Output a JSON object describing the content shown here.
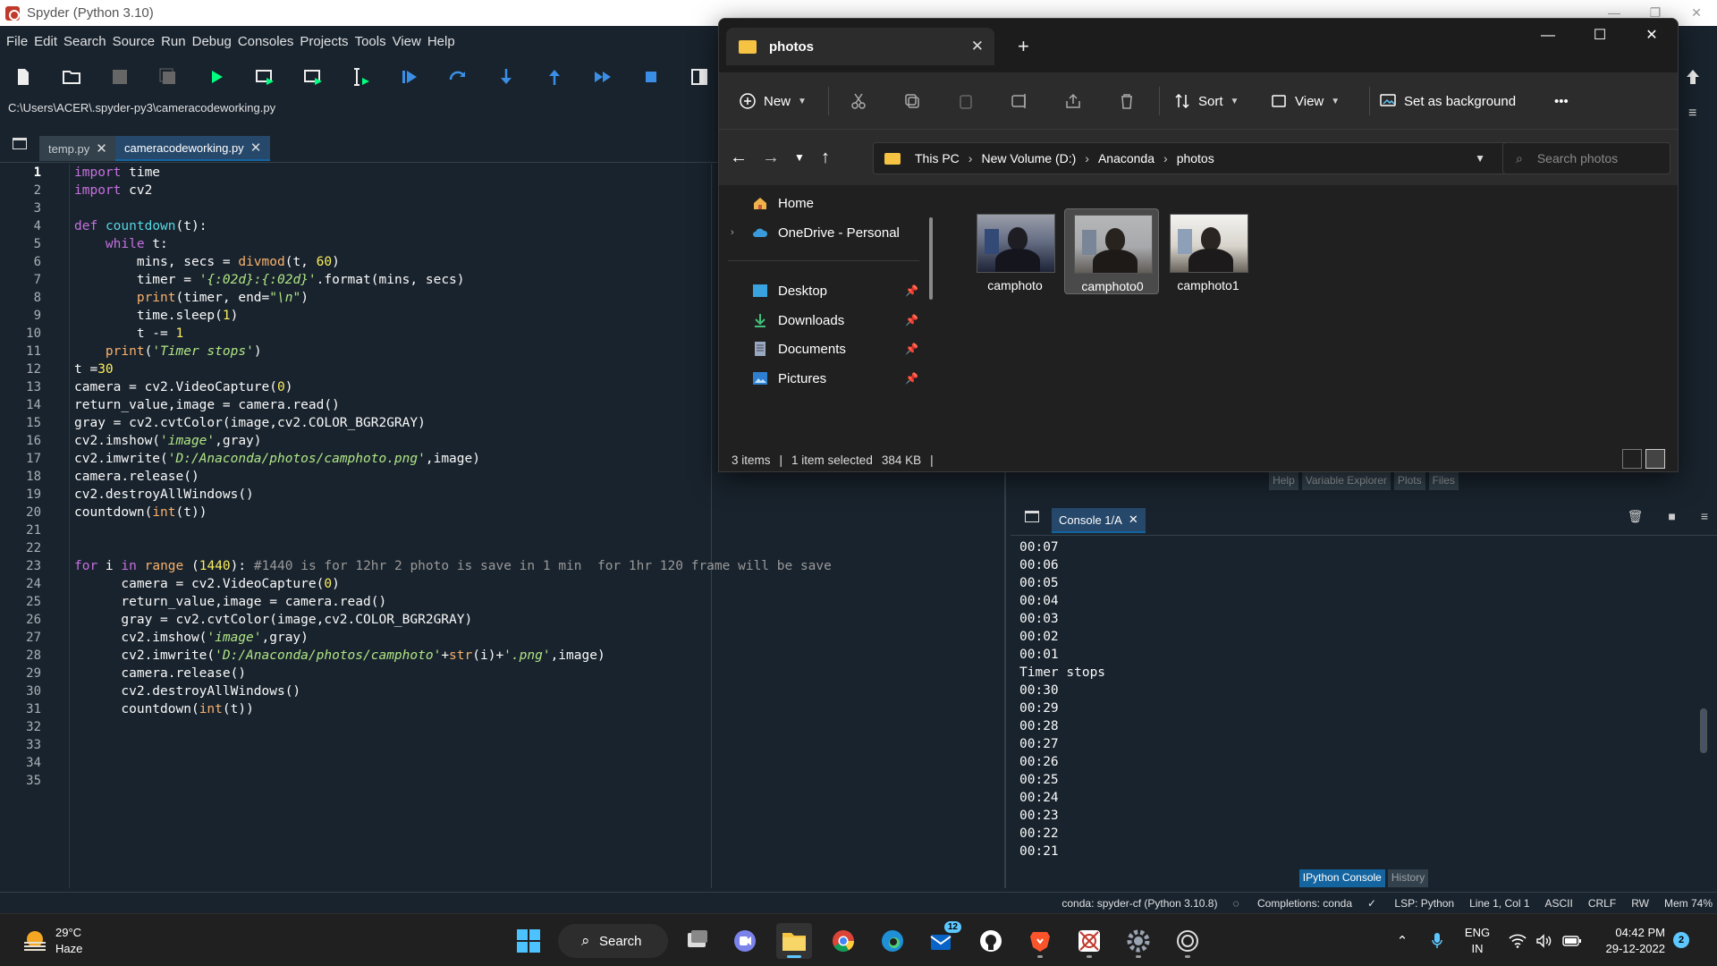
{
  "spyder": {
    "window_title": "Spyder (Python 3.10)",
    "menu": [
      "File",
      "Edit",
      "Search",
      "Source",
      "Run",
      "Debug",
      "Consoles",
      "Projects",
      "Tools",
      "View",
      "Help"
    ],
    "path": "C:\\Users\\ACER\\.spyder-py3\\cameracodeworking.py",
    "tabs": [
      {
        "label": "temp.py",
        "active": false
      },
      {
        "label": "cameracodeworking.py",
        "active": true
      }
    ],
    "line_count": 35,
    "current_line": 1,
    "code": [
      "import time",
      "import cv2",
      "",
      "def countdown(t):",
      "    while t:",
      "        mins, secs = divmod(t, 60)",
      "        timer = '{:02d}:{:02d}'.format(mins, secs)",
      "        print(timer, end=\"\\n\")",
      "        time.sleep(1)",
      "        t -= 1",
      "    print('Timer stops')",
      "t =30",
      "camera = cv2.VideoCapture(0)",
      "return_value,image = camera.read()",
      "gray = cv2.cvtColor(image,cv2.COLOR_BGR2GRAY)",
      "cv2.imshow('image',gray)",
      "cv2.imwrite('D:/Anaconda/photos/camphoto.png',image)",
      "camera.release()",
      "cv2.destroyAllWindows()",
      "countdown(int(t))",
      "",
      "",
      "for i in range (1440): #1440 is for 12hr 2 photo is save in 1 min  for 1hr 120 frame will be save",
      "      camera = cv2.VideoCapture(0)",
      "      return_value,image = camera.read()",
      "      gray = cv2.cvtColor(image,cv2.COLOR_BGR2GRAY)",
      "      cv2.imshow('image',gray)",
      "      cv2.imwrite('D:/Anaconda/photos/camphoto'+str(i)+'.png',image)",
      "      camera.release()",
      "      cv2.destroyAllWindows()",
      "      countdown(int(t))",
      "",
      "",
      "",
      ""
    ],
    "pane_tabs_top": [
      "Help",
      "Variable Explorer",
      "Plots",
      "Files"
    ],
    "console_tab": "Console 1/A",
    "console_output": [
      "00:07",
      "00:06",
      "00:05",
      "00:04",
      "00:03",
      "00:02",
      "00:01",
      "Timer stops",
      "00:30",
      "00:29",
      "00:28",
      "00:27",
      "00:26",
      "00:25",
      "00:24",
      "00:23",
      "00:22",
      "00:21"
    ],
    "pane_tabs_bottom": [
      {
        "label": "IPython Console",
        "active": true
      },
      {
        "label": "History",
        "active": false
      }
    ],
    "status": {
      "env": "conda: spyder-cf (Python 3.10.8)",
      "completions": "Completions: conda",
      "lsp": "LSP: Python",
      "position": "Line 1, Col 1",
      "encoding": "ASCII",
      "eol": "CRLF",
      "rw": "RW",
      "mem": "Mem 74%"
    }
  },
  "explorer": {
    "tab_title": "photos",
    "commands": {
      "new": "New",
      "sort": "Sort",
      "view": "View",
      "set_bg": "Set as background",
      "more": "•••"
    },
    "breadcrumb": [
      "This PC",
      "New Volume (D:)",
      "Anaconda",
      "photos"
    ],
    "search_placeholder": "Search photos",
    "nav": {
      "home": "Home",
      "onedrive": "OneDrive - Personal",
      "quick": [
        "Desktop",
        "Downloads",
        "Documents",
        "Pictures"
      ]
    },
    "files": [
      {
        "name": "camphoto",
        "selected": false
      },
      {
        "name": "camphoto0",
        "selected": true
      },
      {
        "name": "camphoto1",
        "selected": false
      }
    ],
    "status": {
      "items": "3 items",
      "selected": "1 item selected",
      "size": "384 KB"
    }
  },
  "taskbar": {
    "weather_temp": "29°C",
    "weather_desc": "Haze",
    "search_label": "Search",
    "teams_badge": "12",
    "lang_top": "ENG",
    "lang_bottom": "IN",
    "time": "04:42 PM",
    "date": "29-12-2022",
    "notifications": "2"
  },
  "colors": {
    "spyder_bg": "#19232d",
    "accent": "#1464a0",
    "explorer_bg": "#202020",
    "folder_yellow": "#f6c343",
    "taskbar_accent": "#5cc8ff"
  }
}
